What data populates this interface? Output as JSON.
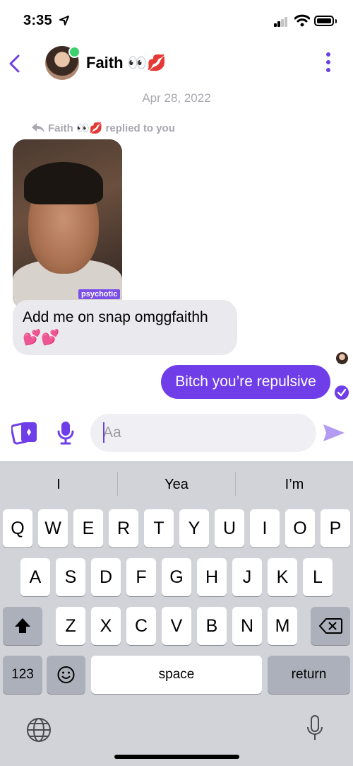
{
  "status_bar": {
    "time": "3:35"
  },
  "header": {
    "contact_name": "Faith 👀💋"
  },
  "chat": {
    "date": "Apr 28, 2022",
    "reply_notice": "Faith 👀💋 replied to you",
    "story_tag": "psychotic",
    "incoming_message": "Add me on snap omggfaithh 💕💕",
    "outgoing_message": "Bitch you’re repulsive"
  },
  "composer": {
    "placeholder": "Aa"
  },
  "keyboard": {
    "suggestions": [
      "I",
      "Yea",
      "I’m"
    ],
    "row1": [
      "Q",
      "W",
      "E",
      "R",
      "T",
      "Y",
      "U",
      "I",
      "O",
      "P"
    ],
    "row2": [
      "A",
      "S",
      "D",
      "F",
      "G",
      "H",
      "J",
      "K",
      "L"
    ],
    "row3": [
      "Z",
      "X",
      "C",
      "V",
      "B",
      "N",
      "M"
    ],
    "numbers_key": "123",
    "space_key": "space",
    "return_key": "return"
  },
  "colors": {
    "accent": "#6f3ee8",
    "online": "#3bd16f"
  }
}
